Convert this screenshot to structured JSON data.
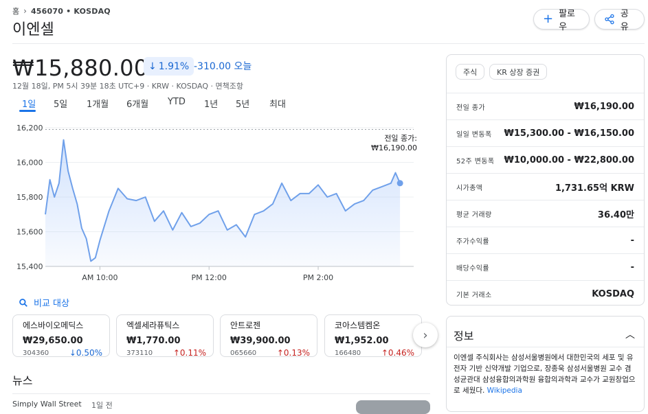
{
  "breadcrumb": {
    "home": "홈",
    "ticker": "456070 • KOSDAQ"
  },
  "title": "이엔셀",
  "buttons": {
    "follow": "팔로우",
    "share": "공유"
  },
  "quote": {
    "price": "₩15,880.00",
    "pct": "1.91%",
    "abs_change": "-310.00 오늘",
    "meta": "12월 18일, PM 5시 39분 18초 UTC+9 · KRW · KOSDAQ · 면책조항"
  },
  "ranges": [
    "1일",
    "5일",
    "1개월",
    "6개월",
    "YTD",
    "1년",
    "5년",
    "최대"
  ],
  "chart_data": {
    "type": "line",
    "yticks": [
      "16,200",
      "16,000",
      "15,800",
      "15,600",
      "15,400"
    ],
    "xticks": [
      "AM 10:00",
      "PM 12:00",
      "PM 2:00"
    ],
    "ylim": [
      15400,
      16200
    ],
    "prev_close_label": "전일 종가:",
    "prev_close_value": "₩16,190.00",
    "prev_close": 16190,
    "series": [
      {
        "x": [
          "09:00",
          "09:05",
          "09:10",
          "09:15",
          "09:20",
          "09:25",
          "09:30",
          "09:35",
          "09:40",
          "09:45",
          "09:50",
          "09:55",
          "10:00",
          "10:10",
          "10:20",
          "10:30",
          "10:40",
          "10:50",
          "11:00",
          "11:10",
          "11:20",
          "11:30",
          "11:40",
          "11:50",
          "12:00",
          "12:10",
          "12:20",
          "12:30",
          "12:40",
          "12:50",
          "13:00",
          "13:10",
          "13:20",
          "13:30",
          "13:40",
          "13:50",
          "14:00",
          "14:10",
          "14:20",
          "14:30",
          "14:40",
          "14:50",
          "15:00",
          "15:10",
          "15:20",
          "15:25",
          "15:30"
        ],
        "y": [
          15700,
          15900,
          15800,
          15880,
          16130,
          15950,
          15850,
          15760,
          15620,
          15560,
          15430,
          15450,
          15550,
          15720,
          15850,
          15790,
          15780,
          15800,
          15660,
          15720,
          15610,
          15710,
          15630,
          15650,
          15700,
          15720,
          15610,
          15640,
          15570,
          15700,
          15720,
          15760,
          15880,
          15780,
          15820,
          15820,
          15870,
          15800,
          15820,
          15720,
          15760,
          15780,
          15840,
          15860,
          15880,
          15940,
          15880
        ]
      }
    ]
  },
  "compare_label": "비교 대상",
  "peers": [
    {
      "name": "에스바이오메딕스",
      "price": "₩29,650.00",
      "code": "304360",
      "change": "0.50%",
      "dir": "down"
    },
    {
      "name": "엑셀세라퓨틱스",
      "price": "₩1,770.00",
      "code": "373110",
      "change": "0.11%",
      "dir": "up"
    },
    {
      "name": "안트로젠",
      "price": "₩39,900.00",
      "code": "065660",
      "change": "0.13%",
      "dir": "up"
    },
    {
      "name": "코아스템켐온",
      "price": "₩1,952.00",
      "code": "166480",
      "change": "0.46%",
      "dir": "up"
    }
  ],
  "news": {
    "heading": "뉴스",
    "source": "Simply Wall Street",
    "time": "1일 전"
  },
  "panel": {
    "chips": [
      "주식",
      "KR 상장 증권"
    ],
    "rows": [
      {
        "k": "전일 종가",
        "v": "₩16,190.00"
      },
      {
        "k": "일일 변동폭",
        "v": "₩15,300.00 - ₩16,150.00"
      },
      {
        "k": "52주 변동폭",
        "v": "₩10,000.00 - ₩22,800.00"
      },
      {
        "k": "시가총액",
        "v": "1,731.65억 KRW"
      },
      {
        "k": "평균 거래량",
        "v": "36.40만"
      },
      {
        "k": "주가수익률",
        "v": "-"
      },
      {
        "k": "배당수익률",
        "v": "-"
      },
      {
        "k": "기본 거래소",
        "v": "KOSDAQ"
      }
    ]
  },
  "info": {
    "heading": "정보",
    "text": "이엔셀 주식회사는 삼성서울병원에서 대한민국의 세포 및 유전자 기반 신약개발 기업으로, 장종욱 삼성서울병원 교수 겸 성균관대 삼성융합의과학원 융합의과학과 교수가 교원창업으로 세웠다.",
    "link": "Wikipedia"
  },
  "colors": {
    "accent": "#1a73e8",
    "down": "#1967d2",
    "up": "#c5221f",
    "line": "#6fa0ea"
  }
}
